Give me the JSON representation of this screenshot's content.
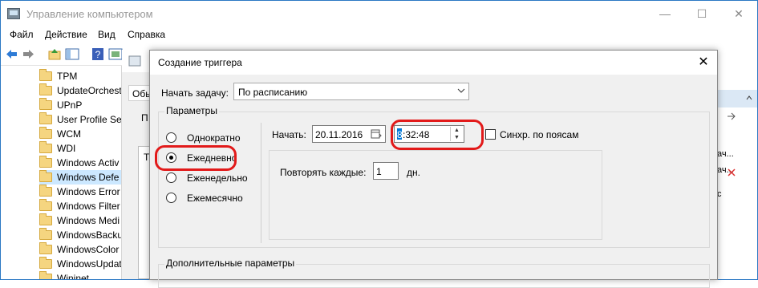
{
  "main_window": {
    "title": "Управление компьютером",
    "controls": {
      "minimize": "—",
      "maximize": "☐",
      "close": "✕"
    },
    "menu": [
      "Файл",
      "Действие",
      "Вид",
      "Справка"
    ]
  },
  "tree": {
    "items": [
      "TPM",
      "UpdateOrchest",
      "UPnP",
      "User Profile Ser",
      "WCM",
      "WDI",
      "Windows Activ",
      "Windows Defe",
      "Windows Error",
      "Windows Filter",
      "Windows Medi",
      "WindowsBacku",
      "WindowsColor",
      "WindowsUpdat",
      "Wininet"
    ],
    "selected_index": 7
  },
  "background": {
    "tab_label": "Обь",
    "partial_label": "П",
    "partial_label2": "Т",
    "right_texts": [
      "ач...",
      "ач...",
      "с"
    ]
  },
  "dialog": {
    "title": "Создание триггера",
    "close": "✕",
    "start_task_label": "Начать задачу:",
    "start_task_value": "По расписанию",
    "params_group": "Параметры",
    "radios": [
      "Однократно",
      "Ежедневно",
      "Еженедельно",
      "Ежемесячно"
    ],
    "selected_radio": 1,
    "start_label": "Начать:",
    "date_value": "20.11.2016",
    "time_value": "8:32:48",
    "time_hour_selected": "8",
    "time_rest": ":32:48",
    "sync_label": "Синхр. по поясам",
    "repeat_label": "Повторять каждые:",
    "repeat_value": "1",
    "repeat_unit": "дн.",
    "advanced_group": "Дополнительные параметры"
  },
  "colors": {
    "highlight_ring": "#e21a1a",
    "selection": "#cce8ff",
    "accent": "#0078d7"
  }
}
